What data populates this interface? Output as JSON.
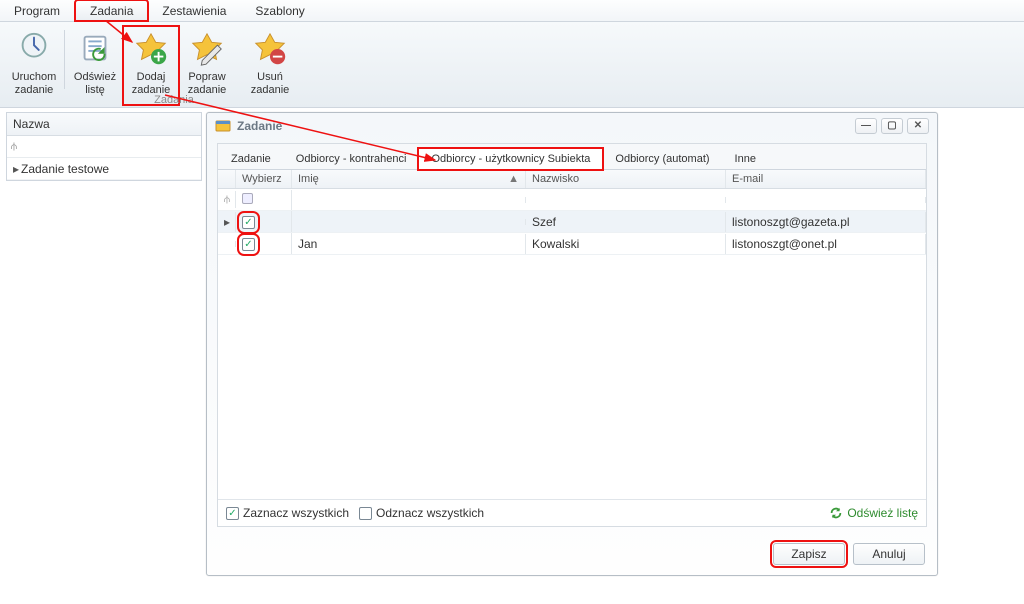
{
  "menubar": {
    "items": [
      "Program",
      "Zadania",
      "Zestawienia",
      "Szablony"
    ],
    "active_index": 1
  },
  "ribbon": {
    "group_label": "Zadania",
    "buttons": [
      {
        "label1": "Uruchom",
        "label2": "zadanie",
        "icon": "run-icon"
      },
      {
        "label1": "Odśwież",
        "label2": "listę",
        "icon": "refresh-icon"
      },
      {
        "label1": "Dodaj",
        "label2": "zadanie",
        "icon": "add-task-icon",
        "highlight": true
      },
      {
        "label1": "Popraw",
        "label2": "zadanie",
        "icon": "edit-task-icon"
      },
      {
        "label1": "Usuń zadanie",
        "label2": "",
        "icon": "delete-task-icon"
      }
    ]
  },
  "leftpane": {
    "header": "Nazwa",
    "rows": [
      "Zadanie testowe"
    ]
  },
  "dialog": {
    "title": "Zadanie",
    "tabs": [
      "Zadanie",
      "Odbiorcy - kontrahenci",
      "Odbiorcy - użytkownicy Subiekta",
      "Odbiorcy (automat)",
      "Inne"
    ],
    "active_tab_index": 2,
    "grid": {
      "columns": [
        "",
        "Wybierz",
        "Imię",
        "Nazwisko",
        "E-mail"
      ],
      "sort_col": 2,
      "rows": [
        {
          "selected": true,
          "checked": true,
          "imie": "",
          "nazwisko": "Szef",
          "email": "listonoszgt@gazeta.pl"
        },
        {
          "selected": false,
          "checked": true,
          "imie": "Jan",
          "nazwisko": "Kowalski",
          "email": "listonoszgt@onet.pl"
        }
      ]
    },
    "checkbar": {
      "select_all": "Zaznacz wszystkich",
      "deselect_all": "Odznacz wszystkich",
      "refresh": "Odśwież listę"
    },
    "buttons": {
      "save": "Zapisz",
      "cancel": "Anuluj"
    }
  }
}
